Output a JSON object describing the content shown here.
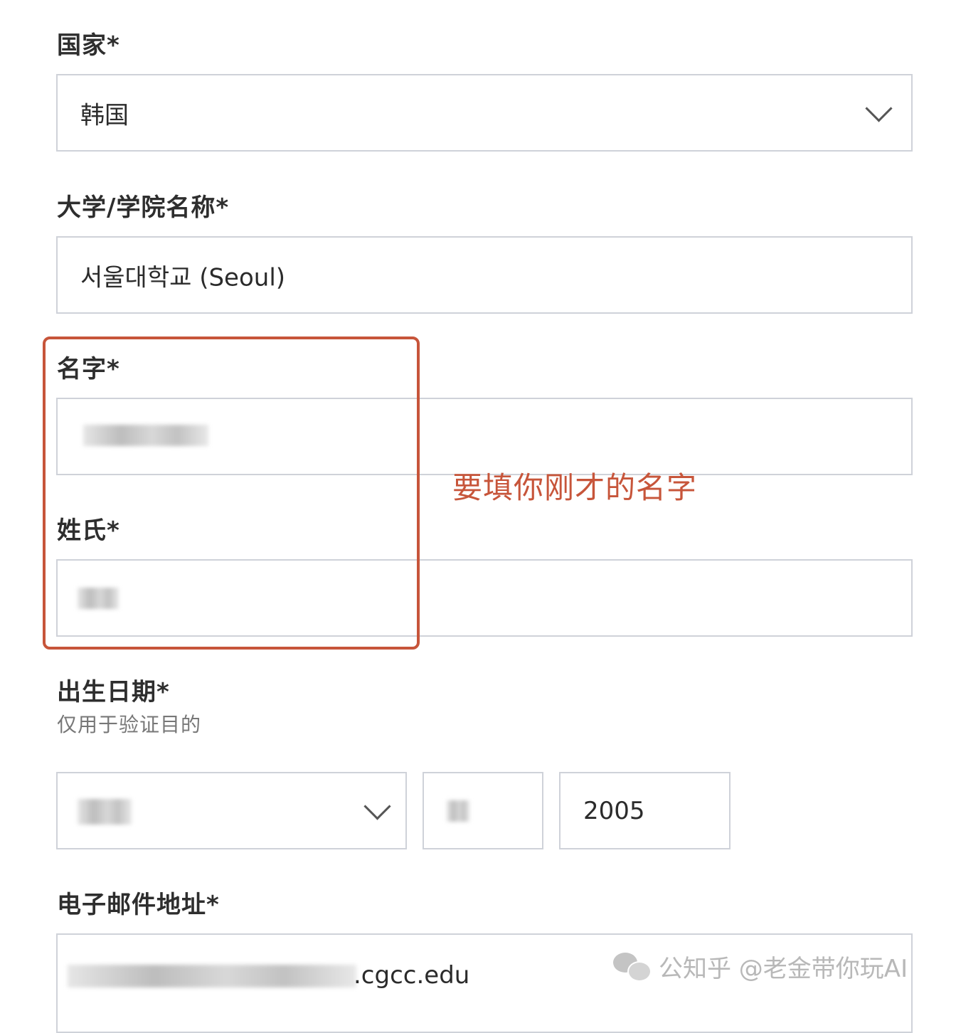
{
  "form": {
    "country": {
      "label": "国家*",
      "value": "韩国"
    },
    "university": {
      "label": "大学/学院名称*",
      "value": "서울대학교 (Seoul)"
    },
    "first_name": {
      "label": "名字*"
    },
    "last_name": {
      "label": "姓氏*"
    },
    "birth_date": {
      "label": "出生日期*",
      "hint": "仅用于验证目的",
      "year": "2005"
    },
    "email": {
      "label": "电子邮件地址*",
      "visible_suffix": ".cgcc.edu"
    }
  },
  "annotation": {
    "text": "要填你刚才的名字",
    "color": "#c7553a"
  },
  "watermark": {
    "icon": "wechat-icon",
    "text": "公知乎 @老金带你玩AI"
  }
}
